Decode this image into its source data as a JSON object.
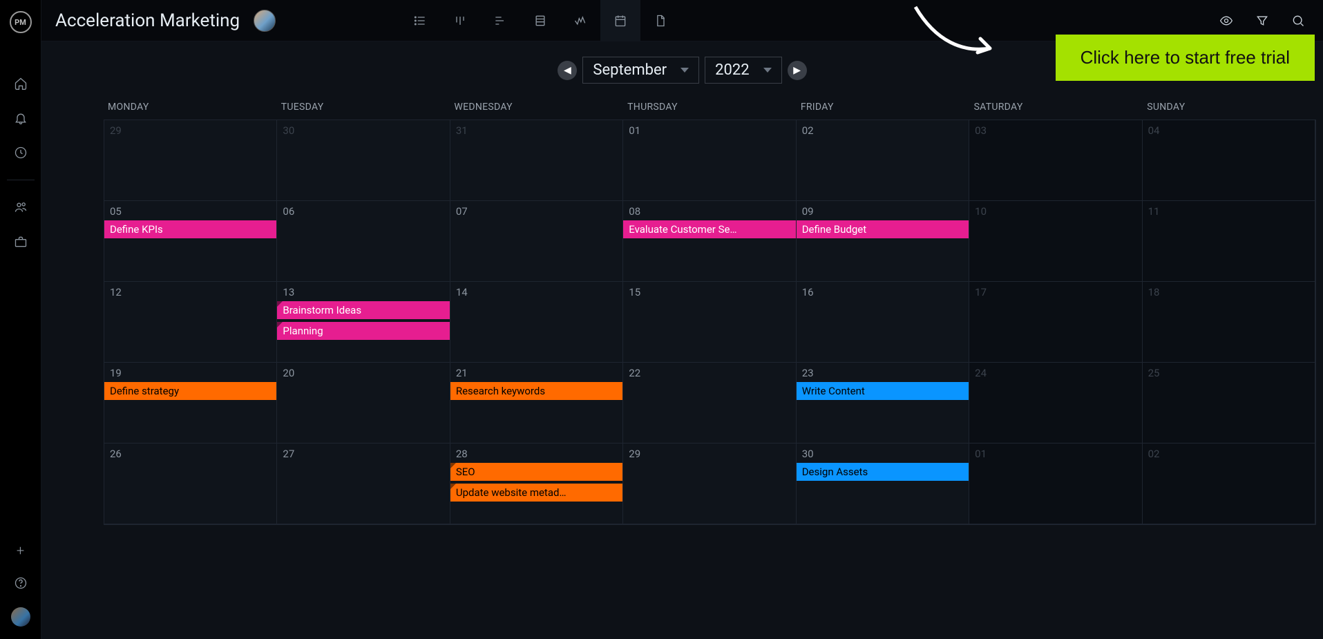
{
  "app": {
    "logo_text": "PM"
  },
  "header": {
    "project_title": "Acceleration Marketing"
  },
  "cta": {
    "label": "Click here to start free trial"
  },
  "date_selector": {
    "month": "September",
    "year": "2022"
  },
  "day_headers": [
    "MONDAY",
    "TUESDAY",
    "WEDNESDAY",
    "THURSDAY",
    "FRIDAY",
    "SATURDAY",
    "SUNDAY"
  ],
  "weeks": [
    [
      {
        "num": "29",
        "out": true
      },
      {
        "num": "30",
        "out": true
      },
      {
        "num": "31",
        "out": true
      },
      {
        "num": "01"
      },
      {
        "num": "02"
      },
      {
        "num": "03",
        "weekend": true,
        "out": true
      },
      {
        "num": "04",
        "weekend": true,
        "out": true
      }
    ],
    [
      {
        "num": "05",
        "events": [
          {
            "label": "Define KPIs",
            "color": "pink"
          }
        ]
      },
      {
        "num": "06"
      },
      {
        "num": "07"
      },
      {
        "num": "08",
        "events": [
          {
            "label": "Evaluate Customer Se…",
            "color": "pink"
          }
        ]
      },
      {
        "num": "09",
        "events": [
          {
            "label": "Define Budget",
            "color": "pink"
          }
        ]
      },
      {
        "num": "10",
        "weekend": true,
        "out": true
      },
      {
        "num": "11",
        "weekend": true,
        "out": true
      }
    ],
    [
      {
        "num": "12"
      },
      {
        "num": "13",
        "events": [
          {
            "label": "Brainstorm Ideas",
            "color": "pink",
            "corner": true
          },
          {
            "label": "Planning",
            "color": "pink",
            "corner": true
          }
        ]
      },
      {
        "num": "14"
      },
      {
        "num": "15"
      },
      {
        "num": "16"
      },
      {
        "num": "17",
        "weekend": true,
        "out": true
      },
      {
        "num": "18",
        "weekend": true,
        "out": true
      }
    ],
    [
      {
        "num": "19",
        "events": [
          {
            "label": "Define strategy",
            "color": "orange"
          }
        ]
      },
      {
        "num": "20"
      },
      {
        "num": "21",
        "events": [
          {
            "label": "Research keywords",
            "color": "orange"
          }
        ]
      },
      {
        "num": "22"
      },
      {
        "num": "23",
        "events": [
          {
            "label": "Write Content",
            "color": "blue"
          }
        ]
      },
      {
        "num": "24",
        "weekend": true,
        "out": true
      },
      {
        "num": "25",
        "weekend": true,
        "out": true
      }
    ],
    [
      {
        "num": "26"
      },
      {
        "num": "27"
      },
      {
        "num": "28",
        "events": [
          {
            "label": "SEO",
            "color": "orange",
            "corner": true
          },
          {
            "label": "Update website metad…",
            "color": "orange",
            "corner": true
          }
        ]
      },
      {
        "num": "29"
      },
      {
        "num": "30",
        "events": [
          {
            "label": "Design Assets",
            "color": "blue"
          }
        ]
      },
      {
        "num": "01",
        "weekend": true,
        "out": true
      },
      {
        "num": "02",
        "weekend": true,
        "out": true
      }
    ]
  ]
}
